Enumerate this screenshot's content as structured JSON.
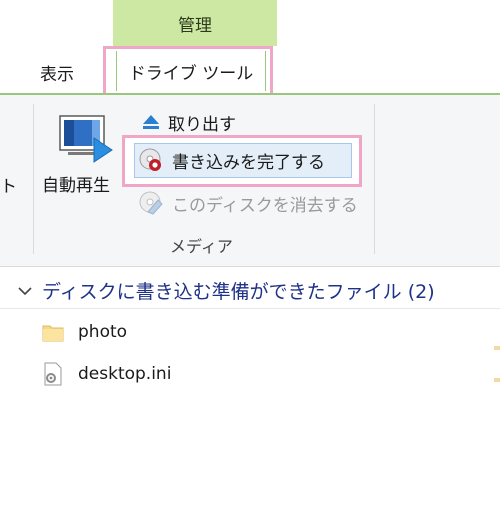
{
  "ribbon": {
    "context_header": "管理",
    "tabs": {
      "view": "表示",
      "drive_tools": "ドライブ ツール"
    },
    "left_fragment": "ト",
    "autoplay_label": "自動再生",
    "commands": {
      "eject": "取り出す",
      "finish_burning": "書き込みを完了する",
      "erase_disc": "このディスクを消去する"
    },
    "group_label": "メディア"
  },
  "files": {
    "section_title": "ディスクに書き込む準備ができたファイル (2)",
    "items": [
      {
        "name": "photo",
        "icon": "folder-icon"
      },
      {
        "name": "desktop.ini",
        "icon": "settings-file-icon"
      }
    ]
  },
  "colors": {
    "context_header_bg": "#cce8a2",
    "highlight_border": "#f0a6c6",
    "ribbon_bg": "#f5f6f7",
    "section_title": "#1e3287",
    "selected_command_bg": "#e4eef8"
  }
}
